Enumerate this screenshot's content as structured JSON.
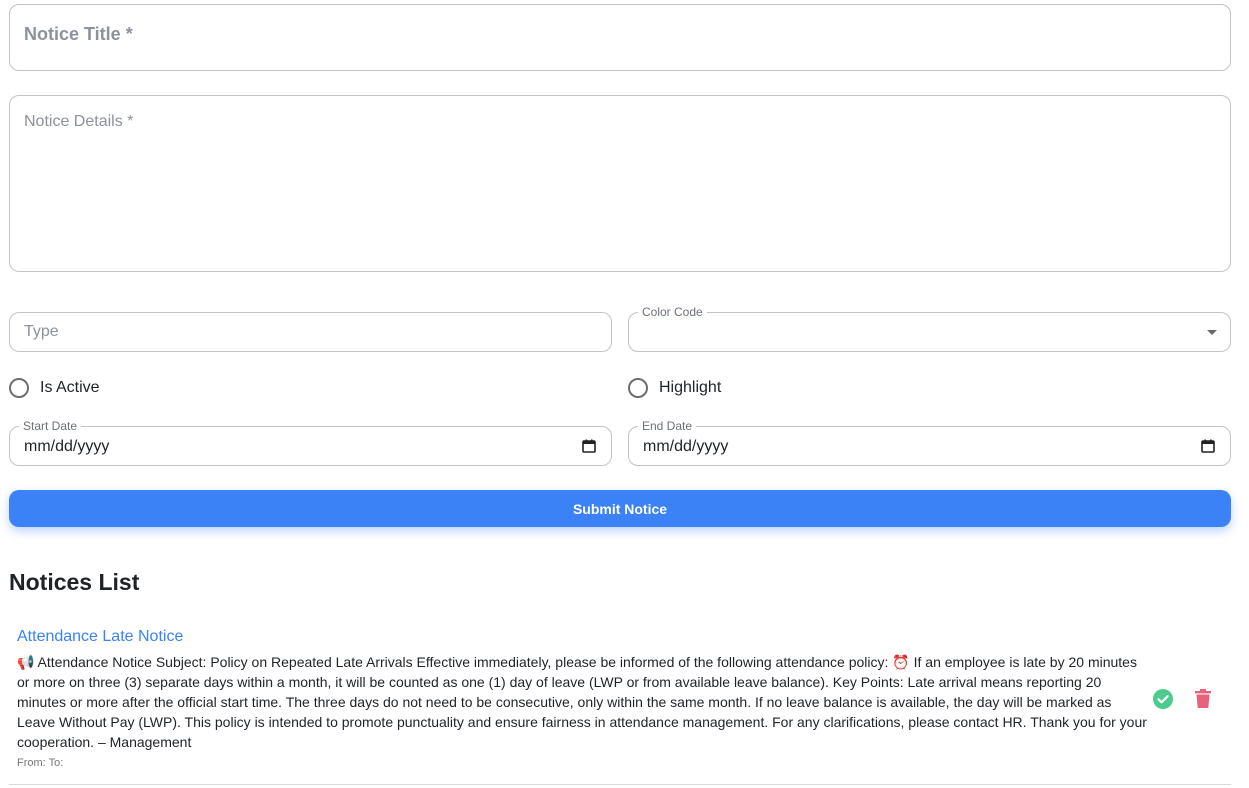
{
  "form": {
    "title_placeholder": "Notice Title *",
    "details_placeholder": "Notice Details *",
    "type_placeholder": "Type",
    "color_code_label": "Color Code",
    "is_active_label": "Is Active",
    "highlight_label": "Highlight",
    "start_date_label": "Start Date",
    "start_date_value": "mm/dd/yyyy",
    "end_date_label": "End Date",
    "end_date_value": "mm/dd/yyyy",
    "submit_label": "Submit Notice"
  },
  "list": {
    "heading": "Notices List",
    "items": [
      {
        "title": "Attendance Late Notice",
        "body": "📢 Attendance Notice Subject: Policy on Repeated Late Arrivals Effective immediately, please be informed of the following attendance policy: ⏰ If an employee is late by 20 minutes or more on three (3) separate days within a month, it will be counted as one (1) day of leave (LWP or from available leave balance). Key Points: Late arrival means reporting 20 minutes or more after the official start time. The three days do not need to be consecutive, only within the same month. If no leave balance is available, the day will be marked as Leave Without Pay (LWP). This policy is intended to promote punctuality and ensure fairness in attendance management. For any clarifications, please contact HR. Thank you for your cooperation. – Management",
        "meta": "From: To:"
      }
    ]
  },
  "colors": {
    "accent": "#3b82f6",
    "approve": "#4ccb8c",
    "delete": "#e8627a",
    "border": "#c4c4c4"
  },
  "icons": {
    "approve": "check-circle-icon",
    "delete": "trash-icon",
    "calendar": "calendar-icon",
    "dropdown": "chevron-down-icon"
  }
}
